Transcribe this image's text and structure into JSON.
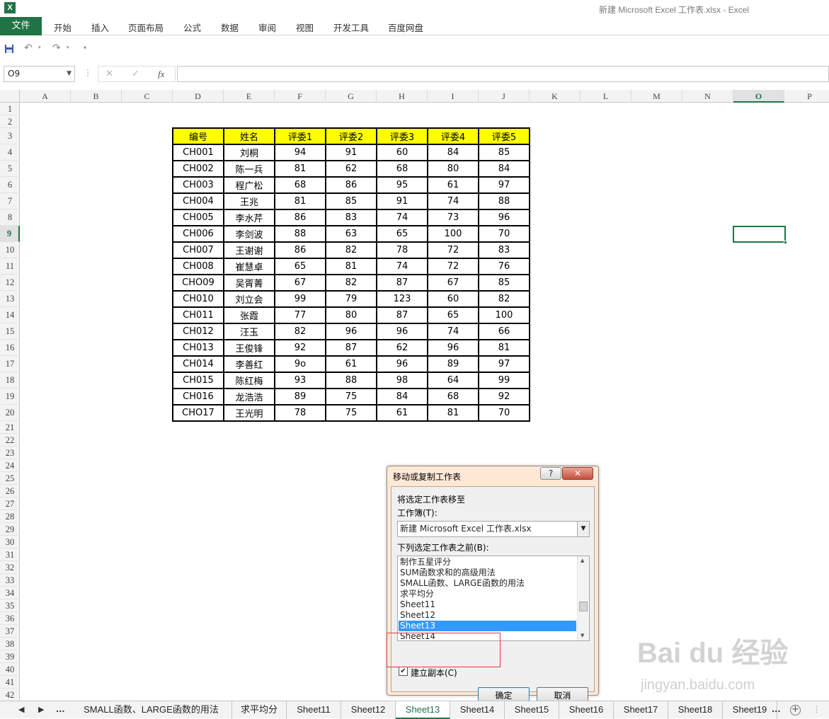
{
  "window": {
    "app_icon": "X",
    "title": "新建 Microsoft Excel 工作表.xlsx - Excel"
  },
  "ribbon": {
    "file_label": "文件",
    "tabs": [
      "开始",
      "插入",
      "页面布局",
      "公式",
      "数据",
      "审阅",
      "视图",
      "开发工具",
      "百度网盘"
    ]
  },
  "quick_access": {
    "save_icon": "save-icon",
    "undo_icon": "undo-icon",
    "redo_icon": "redo-icon",
    "customize_icon": "customize-icon"
  },
  "formula_bar": {
    "name_box": "O9",
    "fx_label": "fx",
    "cancel_glyph": "✕",
    "enter_glyph": "✓",
    "formula_value": ""
  },
  "grid": {
    "columns": [
      "A",
      "B",
      "C",
      "D",
      "E",
      "F",
      "G",
      "H",
      "I",
      "J",
      "K",
      "L",
      "M",
      "N",
      "O",
      "P"
    ],
    "selected_column": "O",
    "rows": [
      "1",
      "2",
      "3",
      "4",
      "5",
      "6",
      "7",
      "8",
      "9",
      "10",
      "11",
      "12",
      "13",
      "14",
      "15",
      "16",
      "17",
      "18",
      "19",
      "20",
      "21",
      "22",
      "23",
      "24",
      "25",
      "26",
      "27",
      "28",
      "29",
      "30",
      "31",
      "32",
      "33",
      "34",
      "35",
      "36",
      "37",
      "38",
      "39",
      "40",
      "41",
      "42"
    ],
    "selected_row": "9"
  },
  "table": {
    "headers": [
      "编号",
      "姓名",
      "评委1",
      "评委2",
      "评委3",
      "评委4",
      "评委5"
    ],
    "rows": [
      [
        "CH001",
        "刘桐",
        "94",
        "91",
        "60",
        "84",
        "85"
      ],
      [
        "CH002",
        "陈一兵",
        "81",
        "62",
        "68",
        "80",
        "84"
      ],
      [
        "CH003",
        "程广松",
        "68",
        "86",
        "95",
        "61",
        "97"
      ],
      [
        "CH004",
        "王兆",
        "81",
        "85",
        "91",
        "74",
        "88"
      ],
      [
        "CH005",
        "李水芹",
        "86",
        "83",
        "74",
        "73",
        "96"
      ],
      [
        "CH006",
        "李剑波",
        "88",
        "63",
        "65",
        "100",
        "70"
      ],
      [
        "CH007",
        "王谢谢",
        "86",
        "82",
        "78",
        "72",
        "83"
      ],
      [
        "CH008",
        "崔慧卓",
        "65",
        "81",
        "74",
        "72",
        "76"
      ],
      [
        "CHO09",
        "吴胥菁",
        "67",
        "82",
        "87",
        "67",
        "85"
      ],
      [
        "CH010",
        "刘立会",
        "99",
        "79",
        "123",
        "60",
        "82"
      ],
      [
        "CH011",
        "张霞",
        "77",
        "80",
        "87",
        "65",
        "100"
      ],
      [
        "CH012",
        "汪玉",
        "82",
        "96",
        "96",
        "74",
        "66"
      ],
      [
        "CH013",
        "王俊锋",
        "92",
        "87",
        "62",
        "96",
        "81"
      ],
      [
        "CH014",
        "李善红",
        "9o",
        "61",
        "96",
        "89",
        "97"
      ],
      [
        "CH015",
        "陈红梅",
        "93",
        "88",
        "98",
        "64",
        "99"
      ],
      [
        "CH016",
        "龙浩浩",
        "89",
        "75",
        "84",
        "68",
        "92"
      ],
      [
        "CHO17",
        "王光明",
        "78",
        "75",
        "61",
        "81",
        "70"
      ]
    ]
  },
  "dialog": {
    "title": "移动或复制工作表",
    "help_glyph": "?",
    "close_glyph": "✕",
    "move_to_label": "将选定工作表移至",
    "workbook_label": "工作簿(T):",
    "workbook_value": "新建 Microsoft Excel 工作表.xlsx",
    "before_sheet_label": "下列选定工作表之前(B):",
    "sheet_list": [
      "制作五星评分",
      "SUM函数求和的高级用法",
      "SMALL函数、LARGE函数的用法",
      "求平均分",
      "Sheet11",
      "Sheet12",
      "Sheet13",
      "Sheet14"
    ],
    "selected_sheet": "Sheet13",
    "create_copy_label": "建立副本(C)",
    "create_copy_checked": true,
    "ok_label": "确定",
    "cancel_label": "取消"
  },
  "sheet_tabs": {
    "nav_prev": "◀",
    "nav_next": "▶",
    "more": "...",
    "tabs": [
      "SMALL函数、LARGE函数的用法",
      "求平均分",
      "Sheet11",
      "Sheet12",
      "Sheet13",
      "Sheet14",
      "Sheet15",
      "Sheet16",
      "Sheet17",
      "Sheet18",
      "Sheet19"
    ],
    "active": "Sheet13",
    "add_glyph": "+",
    "trailing_more": "..."
  },
  "watermark": {
    "logo": "Bai du 经验",
    "url": "jingyan.baidu.com"
  },
  "colors": {
    "excel_green": "#217346",
    "header_yellow": "#ffff00",
    "dialog_frame": "#ffe9d6",
    "list_selection": "#3399ff",
    "annotation_red": "#e0393e"
  }
}
